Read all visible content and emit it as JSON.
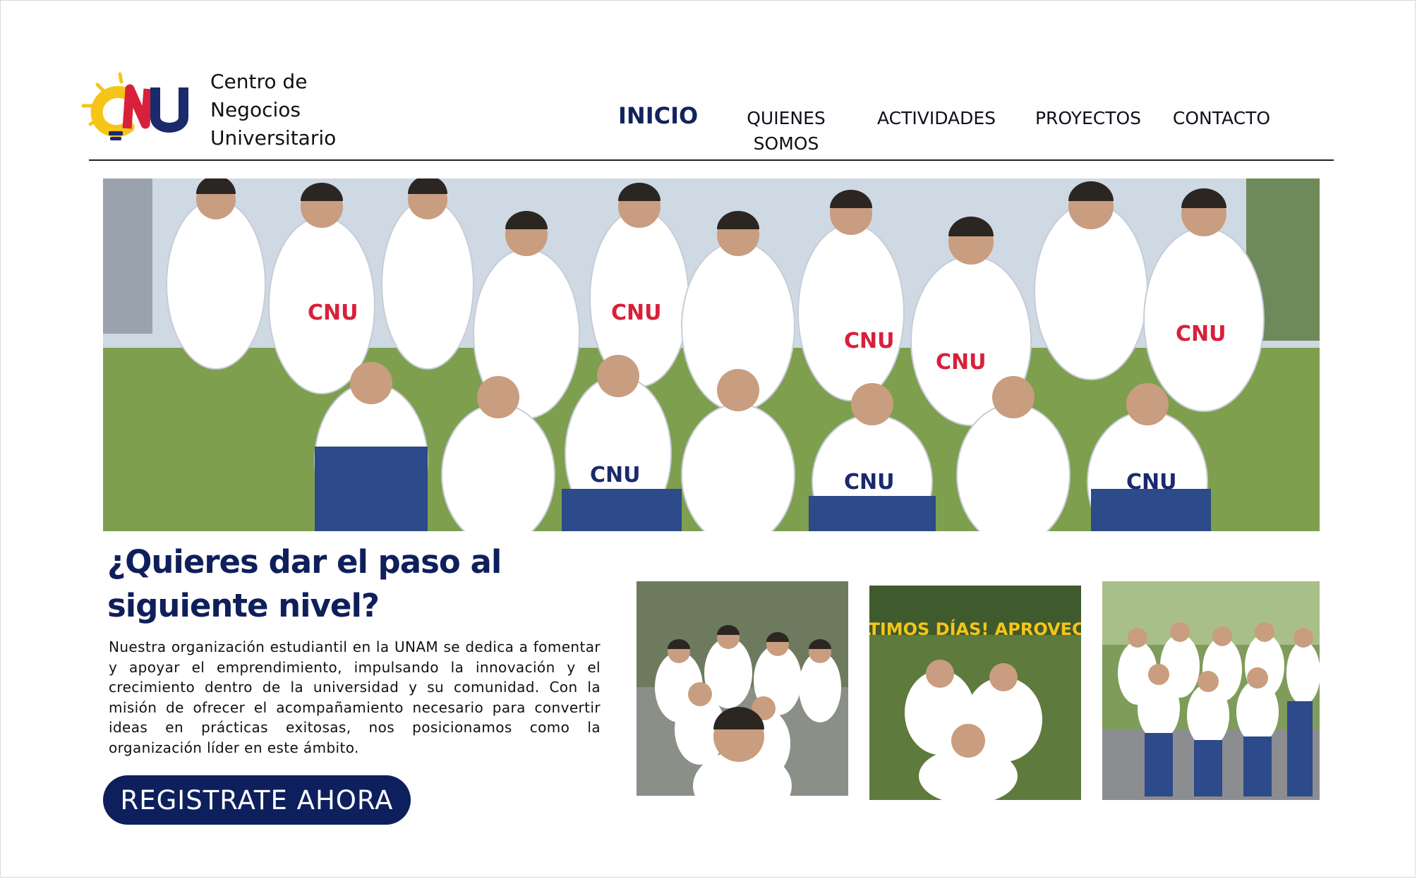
{
  "brand": {
    "logo_text": "CNU",
    "name_lines": [
      "Centro de",
      "Negocios",
      "Universitario"
    ]
  },
  "nav": {
    "items": [
      {
        "label": "INICIO",
        "active": true
      },
      {
        "label": "QUIENES SOMOS",
        "label_line1": "QUIENES",
        "label_line2": "SOMOS",
        "active": false
      },
      {
        "label": "ACTIVIDADES",
        "active": false
      },
      {
        "label": "PROYECTOS",
        "active": false
      },
      {
        "label": "CONTACTO",
        "active": false
      }
    ]
  },
  "hero": {
    "image": "group-photo-students-cnu-shirts"
  },
  "promo": {
    "headline_line1": "¿Quieres dar el paso al",
    "headline_line2": "siguiente nivel?",
    "body": "Nuestra organización estudiantil en la UNAM se dedica a fomentar y apoyar el emprendimiento, impulsando la innovación y el crecimiento dentro de la universidad y su comunidad. Con la misión de ofrecer el acompañamiento necesario para convertir ideas en prácticas exitosas, nos posicionamos como la organización líder en este ámbito.",
    "cta_label": "REGISTRATE AHORA"
  },
  "gallery": {
    "photo2_overlay_text": "¡ÚLTIMOS DÍAS! APROVECHA"
  },
  "colors": {
    "navy": "#0e1f5e",
    "accent_red": "#d8203a",
    "accent_yellow": "#f5c518",
    "grass": "#6f8f47"
  }
}
